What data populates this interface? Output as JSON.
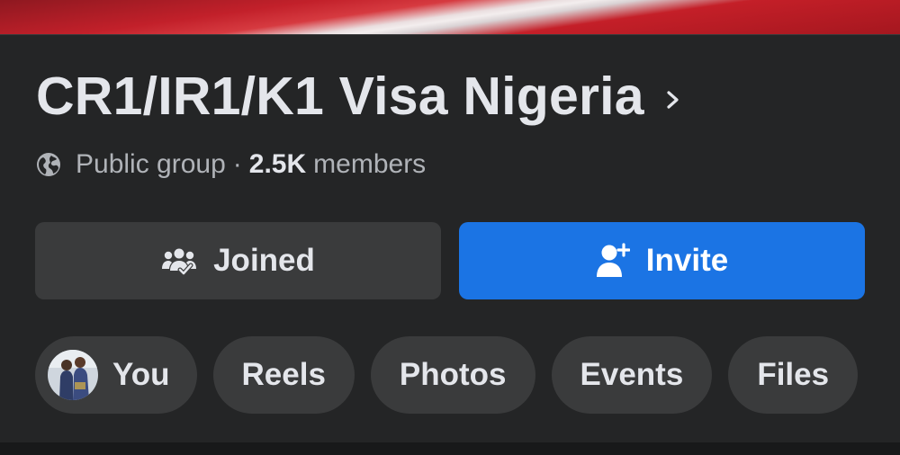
{
  "group": {
    "name": "CR1/IR1/K1 Visa Nigeria",
    "privacy": "Public group",
    "separator": "·",
    "member_count": "2.5K",
    "member_suffix": "members"
  },
  "actions": {
    "joined_label": "Joined",
    "invite_label": "Invite"
  },
  "tabs": [
    {
      "label": "You"
    },
    {
      "label": "Reels"
    },
    {
      "label": "Photos"
    },
    {
      "label": "Events"
    },
    {
      "label": "Files"
    }
  ],
  "icons": {
    "title_chevron": "chevron-right-icon",
    "privacy": "globe-icon",
    "joined": "group-members-icon",
    "invite": "add-person-icon",
    "you_tab": "avatar"
  },
  "colors": {
    "background": "#242526",
    "button_secondary": "#3a3b3c",
    "button_primary": "#1b74e4",
    "text_primary": "#e4e6eb",
    "text_secondary": "#b0b3b8"
  }
}
